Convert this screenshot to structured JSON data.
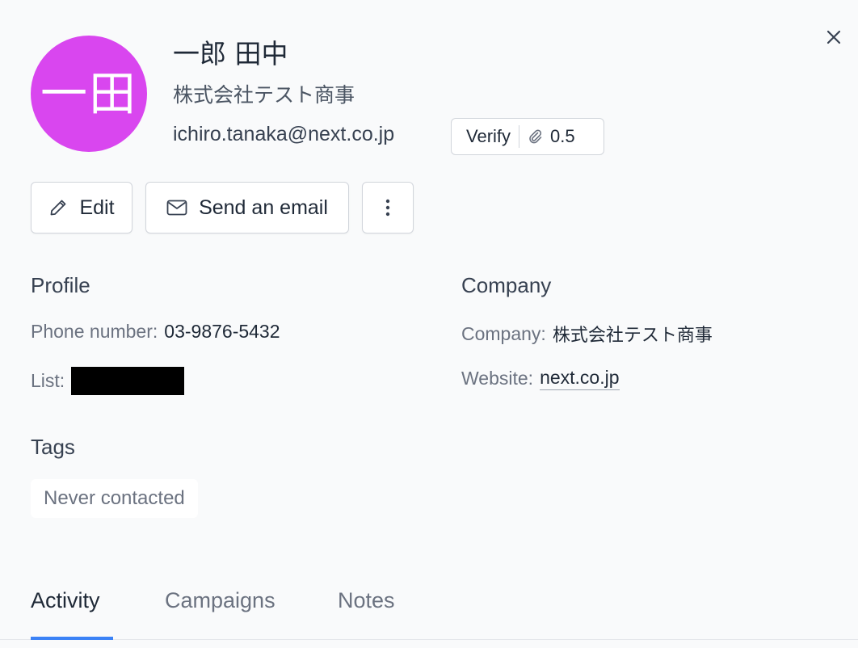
{
  "contact": {
    "avatar_initials": "一田",
    "avatar_color": "#d946ef",
    "name": "一郎 田中",
    "company": "株式会社テスト商事",
    "email": "ichiro.tanaka@next.co.jp"
  },
  "verify": {
    "label": "Verify",
    "score": "0.5",
    "score_icon": "paperclip-icon"
  },
  "actions": {
    "edit_label": "Edit",
    "send_email_label": "Send an email",
    "more_icon": "more-vertical-icon"
  },
  "profile": {
    "title": "Profile",
    "phone_label": "Phone number:",
    "phone_value": "03-9876-5432",
    "list_label": "List:"
  },
  "company_section": {
    "title": "Company",
    "company_label": "Company:",
    "company_value": "株式会社テスト商事",
    "website_label": "Website:",
    "website_value": "next.co.jp"
  },
  "tags": {
    "title": "Tags",
    "items": [
      "Never contacted"
    ]
  },
  "tabs": [
    {
      "label": "Activity",
      "active": true
    },
    {
      "label": "Campaigns",
      "active": false
    },
    {
      "label": "Notes",
      "active": false
    }
  ],
  "colors": {
    "accent": "#3b82f6",
    "avatar": "#d946ef"
  }
}
